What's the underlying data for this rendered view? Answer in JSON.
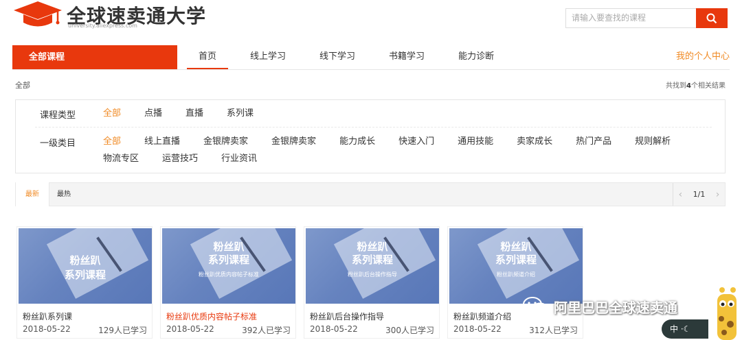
{
  "header": {
    "title": "全球速卖通大学",
    "subtitle": "university.aliexpress.com",
    "search_placeholder": "请输入要查找的课程"
  },
  "nav": {
    "all_courses": "全部课程",
    "tabs": [
      {
        "label": "首页",
        "active": true
      },
      {
        "label": "线上学习"
      },
      {
        "label": "线下学习"
      },
      {
        "label": "书籍学习"
      },
      {
        "label": "能力诊断"
      }
    ],
    "my_center": "我的个人中心"
  },
  "breadcrumb": "全部",
  "result": {
    "prefix": "共找到",
    "count": "4",
    "suffix": "个相关结果"
  },
  "filters": {
    "type": {
      "label": "课程类型",
      "options": [
        "全部",
        "点播",
        "直播",
        "系列课"
      ]
    },
    "category": {
      "label": "一级类目",
      "options": [
        "全部",
        "线上直播",
        "金银牌卖家",
        "金银牌卖家",
        "能力成长",
        "快速入门",
        "通用技能",
        "卖家成长",
        "热门产品",
        "规则解析",
        "物流专区",
        "运营技巧",
        "行业资讯"
      ]
    }
  },
  "sort": {
    "newest": "最新",
    "hottest": "最热",
    "page": "1/1"
  },
  "courses": [
    {
      "thumb_line1": "粉丝趴",
      "thumb_line2": "系列课程",
      "thumb_line3": "",
      "title": "粉丝趴系列课",
      "date": "2018-05-22",
      "learners": "129人已学习",
      "highlight": false
    },
    {
      "thumb_line1": "粉丝趴",
      "thumb_line2": "系列课程",
      "thumb_line3": "粉丝趴优质内容帖子标准",
      "title": "粉丝趴优质内容帖子标准",
      "date": "2018-05-22",
      "learners": "392人已学习",
      "highlight": true
    },
    {
      "thumb_line1": "粉丝趴",
      "thumb_line2": "系列课程",
      "thumb_line3": "粉丝趴后台操作指导",
      "title": "粉丝趴后台操作指导",
      "date": "2018-05-22",
      "learners": "300人已学习",
      "highlight": false
    },
    {
      "thumb_line1": "粉丝趴",
      "thumb_line2": "系列课程",
      "thumb_line3": "粉丝趴频道介绍",
      "title": "粉丝趴频道介绍",
      "date": "2018-05-22",
      "learners": "312人已学习",
      "highlight": false
    }
  ],
  "watermark": {
    "text": "阿里巴巴全球速卖通",
    "lang": "中"
  },
  "colors": {
    "accent": "#e8380d",
    "orange": "#f08a24"
  }
}
